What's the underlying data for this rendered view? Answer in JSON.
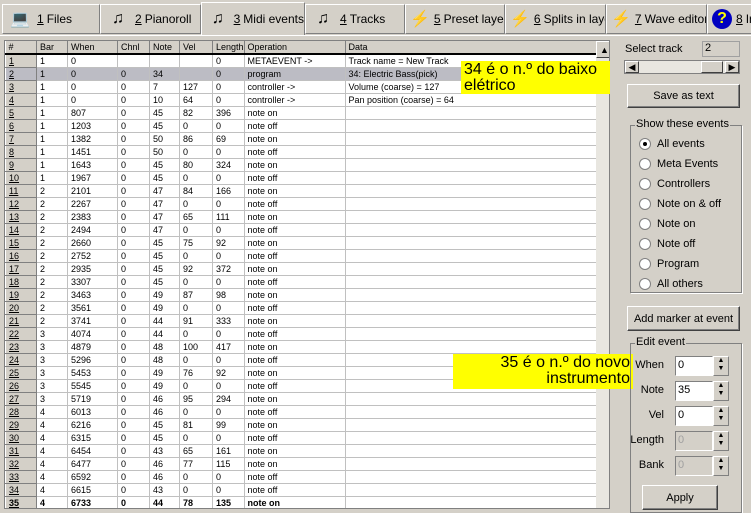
{
  "tabs": [
    {
      "num": "1",
      "label": "Files",
      "icon": "laptop-icon"
    },
    {
      "num": "2",
      "label": "Pianoroll",
      "icon": "note-document-icon"
    },
    {
      "num": "3",
      "label": "Midi events",
      "icon": "note-document-icon",
      "active": true
    },
    {
      "num": "4",
      "label": "Tracks",
      "icon": "note-document-icon"
    },
    {
      "num": "5",
      "label": "Preset layers",
      "icon": "sound-wave-icon"
    },
    {
      "num": "6",
      "label": "Splits in layer",
      "icon": "sound-wave-icon"
    },
    {
      "num": "7",
      "label": "Wave editor",
      "icon": "sound-wave-icon"
    },
    {
      "num": "8",
      "label": "In",
      "icon": "help-icon"
    }
  ],
  "table": {
    "columns": [
      "#",
      "Bar",
      "When",
      "Chnl",
      "Note",
      "Vel",
      "Length",
      "Operation",
      "Data"
    ],
    "rows": [
      [
        "1",
        "1",
        "0",
        "",
        "",
        "",
        "0",
        "METAEVENT ->",
        "Track name = New Track"
      ],
      [
        "2",
        "1",
        "0",
        "0",
        "34",
        "",
        "0",
        "program",
        "34: Electric Bass(pick)"
      ],
      [
        "3",
        "1",
        "0",
        "0",
        "7",
        "127",
        "0",
        "controller ->",
        "Volume (coarse) = 127"
      ],
      [
        "4",
        "1",
        "0",
        "0",
        "10",
        "64",
        "0",
        "controller ->",
        "Pan position (coarse) = 64"
      ],
      [
        "5",
        "1",
        "807",
        "0",
        "45",
        "82",
        "396",
        "note on",
        ""
      ],
      [
        "6",
        "1",
        "1203",
        "0",
        "45",
        "0",
        "0",
        "note off",
        ""
      ],
      [
        "7",
        "1",
        "1382",
        "0",
        "50",
        "86",
        "69",
        "note on",
        ""
      ],
      [
        "8",
        "1",
        "1451",
        "0",
        "50",
        "0",
        "0",
        "note off",
        ""
      ],
      [
        "9",
        "1",
        "1643",
        "0",
        "45",
        "80",
        "324",
        "note on",
        ""
      ],
      [
        "10",
        "1",
        "1967",
        "0",
        "45",
        "0",
        "0",
        "note off",
        ""
      ],
      [
        "11",
        "2",
        "2101",
        "0",
        "47",
        "84",
        "166",
        "note on",
        ""
      ],
      [
        "12",
        "2",
        "2267",
        "0",
        "47",
        "0",
        "0",
        "note off",
        ""
      ],
      [
        "13",
        "2",
        "2383",
        "0",
        "47",
        "65",
        "111",
        "note on",
        ""
      ],
      [
        "14",
        "2",
        "2494",
        "0",
        "47",
        "0",
        "0",
        "note off",
        ""
      ],
      [
        "15",
        "2",
        "2660",
        "0",
        "45",
        "75",
        "92",
        "note on",
        ""
      ],
      [
        "16",
        "2",
        "2752",
        "0",
        "45",
        "0",
        "0",
        "note off",
        ""
      ],
      [
        "17",
        "2",
        "2935",
        "0",
        "45",
        "92",
        "372",
        "note on",
        ""
      ],
      [
        "18",
        "2",
        "3307",
        "0",
        "45",
        "0",
        "0",
        "note off",
        ""
      ],
      [
        "19",
        "2",
        "3463",
        "0",
        "49",
        "87",
        "98",
        "note on",
        ""
      ],
      [
        "20",
        "2",
        "3561",
        "0",
        "49",
        "0",
        "0",
        "note off",
        ""
      ],
      [
        "21",
        "2",
        "3741",
        "0",
        "44",
        "91",
        "333",
        "note on",
        ""
      ],
      [
        "22",
        "3",
        "4074",
        "0",
        "44",
        "0",
        "0",
        "note off",
        ""
      ],
      [
        "23",
        "3",
        "4879",
        "0",
        "48",
        "100",
        "417",
        "note on",
        ""
      ],
      [
        "24",
        "3",
        "5296",
        "0",
        "48",
        "0",
        "0",
        "note off",
        ""
      ],
      [
        "25",
        "3",
        "5453",
        "0",
        "49",
        "76",
        "92",
        "note on",
        ""
      ],
      [
        "26",
        "3",
        "5545",
        "0",
        "49",
        "0",
        "0",
        "note off",
        ""
      ],
      [
        "27",
        "3",
        "5719",
        "0",
        "46",
        "95",
        "294",
        "note on",
        ""
      ],
      [
        "28",
        "4",
        "6013",
        "0",
        "46",
        "0",
        "0",
        "note off",
        ""
      ],
      [
        "29",
        "4",
        "6216",
        "0",
        "45",
        "81",
        "99",
        "note on",
        ""
      ],
      [
        "30",
        "4",
        "6315",
        "0",
        "45",
        "0",
        "0",
        "note off",
        ""
      ],
      [
        "31",
        "4",
        "6454",
        "0",
        "43",
        "65",
        "161",
        "note on",
        ""
      ],
      [
        "32",
        "4",
        "6477",
        "0",
        "46",
        "77",
        "115",
        "note on",
        ""
      ],
      [
        "33",
        "4",
        "6592",
        "0",
        "46",
        "0",
        "0",
        "note off",
        ""
      ],
      [
        "34",
        "4",
        "6615",
        "0",
        "43",
        "0",
        "0",
        "note off",
        ""
      ],
      [
        "35",
        "4",
        "6733",
        "0",
        "44",
        "78",
        "135",
        "note on",
        ""
      ]
    ],
    "selected_row": "2",
    "bold_row": "35"
  },
  "annotations": {
    "note1": "34 é o n.º do baixo elétrico",
    "note2": "35 é o n.º do novo instrumento"
  },
  "panel": {
    "select_track_label": "Select track",
    "select_track_value": "2",
    "save_as_text": "Save as text",
    "show_events_title": "Show these events",
    "events": [
      {
        "label": "All events",
        "checked": true
      },
      {
        "label": "Meta Events",
        "checked": false
      },
      {
        "label": "Controllers",
        "checked": false
      },
      {
        "label": "Note on & off",
        "checked": false
      },
      {
        "label": "Note on",
        "checked": false
      },
      {
        "label": "Note off",
        "checked": false
      },
      {
        "label": "Program",
        "checked": false
      },
      {
        "label": "All others",
        "checked": false
      }
    ],
    "add_marker": "Add marker at event",
    "edit_event_title": "Edit event",
    "fields": [
      {
        "label": "When",
        "value": "0",
        "disabled": false
      },
      {
        "label": "Note",
        "value": "35",
        "disabled": false
      },
      {
        "label": "Vel",
        "value": "0",
        "disabled": false
      },
      {
        "label": "Length",
        "value": "0",
        "disabled": true
      },
      {
        "label": "Bank",
        "value": "0",
        "disabled": true
      }
    ],
    "apply": "Apply"
  },
  "colors": {
    "annotation": "#ffff00",
    "selected_row": "#bcbcc4",
    "face": "#d4d0c8"
  }
}
